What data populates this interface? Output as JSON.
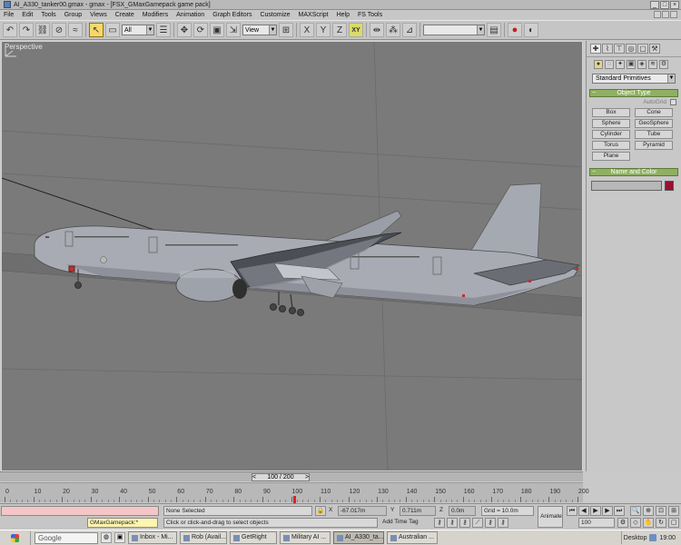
{
  "window": {
    "title": "AI_A330_tanker00.gmax - gmax - [FSX_GMaxGamepack game pack]",
    "controls": [
      "_",
      "□",
      "×"
    ]
  },
  "menu": [
    "File",
    "Edit",
    "Tools",
    "Group",
    "Views",
    "Create",
    "Modifiers",
    "Animation",
    "Graph Editors",
    "Customize",
    "MAXScript",
    "Help",
    "FS Tools"
  ],
  "toolbar": {
    "filter_value": "All",
    "refcoord_value": "View",
    "xy_label": "XY",
    "named_sel_value": ""
  },
  "viewport": {
    "label": "Perspective"
  },
  "command_panel": {
    "category_dropdown": "Standard Primitives",
    "object_type_title": "Object Type",
    "autogrid_label": "AutoGrid",
    "primitives": [
      "Box",
      "Cone",
      "Sphere",
      "GeoSphere",
      "Cylinder",
      "Tube",
      "Torus",
      "Pyramid",
      "Plane"
    ],
    "name_color_title": "Name and Color",
    "name_value": ""
  },
  "time_slider": {
    "label": "100 / 200",
    "prev": "<",
    "next": ">"
  },
  "track_bar": {
    "ticks": [
      "0",
      "10",
      "20",
      "30",
      "40",
      "50",
      "60",
      "70",
      "80",
      "90",
      "100",
      "110",
      "120",
      "130",
      "140",
      "150",
      "160",
      "170",
      "180",
      "190",
      "200"
    ]
  },
  "status": {
    "maxscript_listener": "",
    "maxscript_field": "GMaxGamepack:*",
    "selection": "None Selected",
    "prompt": "Click or click-and-drag to select objects",
    "x_value": "-67.017m",
    "y_value": "0.711m",
    "z_value": "0.0m",
    "grid": "Grid = 10.0m",
    "add_time_tag": "Add Time Tag",
    "animate": "Animate",
    "frame_value": "100",
    "x_label": "X",
    "y_label": "Y",
    "z_label": "Z"
  },
  "taskbar": {
    "start": "start",
    "search": "Google",
    "tasks": [
      {
        "label": "Inbox - Mi...",
        "active": false
      },
      {
        "label": "Rob (Avail...",
        "active": false
      },
      {
        "label": "GetRight",
        "active": false
      },
      {
        "label": "Military AI ...",
        "active": false
      },
      {
        "label": "AI_A330_ta...",
        "active": true
      },
      {
        "label": "Australian ...",
        "active": false
      }
    ],
    "desktop": "Desktop",
    "clock": "19:00"
  }
}
